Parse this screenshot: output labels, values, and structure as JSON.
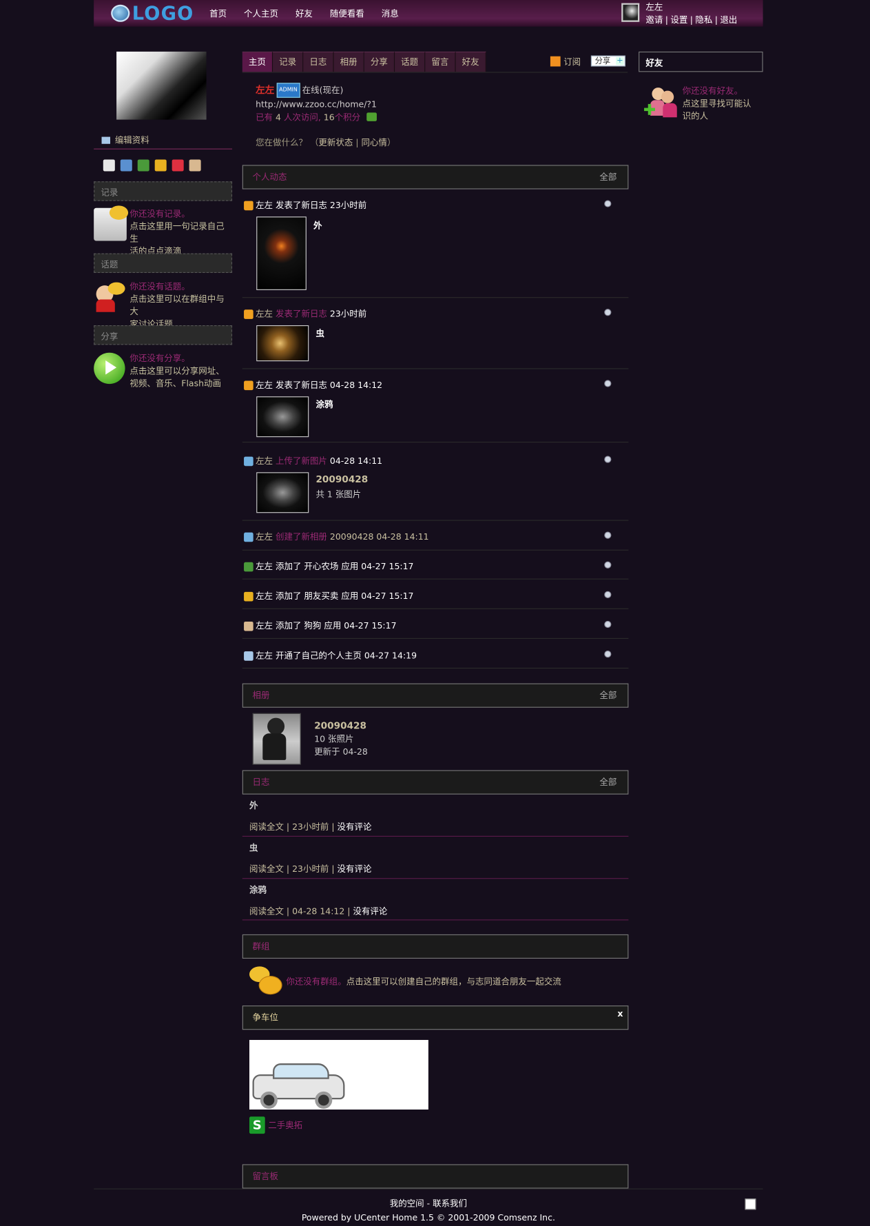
{
  "header": {
    "logo_text": "LOGO",
    "nav": [
      "首页",
      "个人主页",
      "好友",
      "随便看看",
      "消息"
    ],
    "user_name": "左左",
    "user_links": [
      "邀请",
      "设置",
      "隐私",
      "退出"
    ]
  },
  "sidebar": {
    "edit_profile": "编辑资料",
    "sections": [
      {
        "title": "记录",
        "empty": "你还没有记录。",
        "desc1": "点击这里用一句记录自己生",
        "desc2": "活的点点滴滴"
      },
      {
        "title": "话题",
        "empty": "你还没有话题。",
        "desc1": "点击这里可以在群组中与大",
        "desc2": "家讨论话题"
      },
      {
        "title": "分享",
        "empty": "你还没有分享。",
        "desc1": "点击这里可以分享网址、",
        "desc2": "视频、音乐、Flash动画"
      }
    ]
  },
  "tabs": [
    "主页",
    "记录",
    "日志",
    "相册",
    "分享",
    "话题",
    "留言",
    "好友"
  ],
  "toolbar": {
    "subscribe": "订阅",
    "share": "分享",
    "share_plus": "+"
  },
  "profile": {
    "name": "左左",
    "badge": "ADMIN",
    "online": "在线(现在)",
    "url": "http://www.zzoo.cc/home/?1",
    "stats_pre": "已有",
    "visits": "4",
    "visits_label": "人次访问,",
    "points": "16",
    "points_label": "个积分",
    "status_question": "您在做什么？",
    "update_status": "更新状态",
    "mood": "同心情"
  },
  "feed_box": {
    "title": "个人动态",
    "more": "全部"
  },
  "feed": [
    {
      "user": "左左",
      "action": "发表了新日志",
      "time": "23小时前",
      "title": "外"
    },
    {
      "user": "左左",
      "action": "发表了新日志",
      "time": "23小时前",
      "title": "虫"
    },
    {
      "user": "左左",
      "action": "发表了新日志",
      "time": "04-28 14:12",
      "title": "涂鸦"
    },
    {
      "user": "左左",
      "action": "上传了新图片",
      "time": "04-28 14:11",
      "title": "20090428",
      "sub": "共 1 张图片"
    },
    {
      "user": "左左",
      "action": "创建了新相册",
      "time": "20090428 04-28 14:11"
    },
    {
      "user": "左左",
      "action": "添加了 开心农场 应用",
      "time": "04-27 15:17"
    },
    {
      "user": "左左",
      "action": "添加了 朋友买卖 应用",
      "time": "04-27 15:17"
    },
    {
      "user": "左左",
      "action": "添加了 狗狗 应用",
      "time": "04-27 15:17"
    },
    {
      "user": "左左",
      "action": "开通了自己的个人主页",
      "time": "04-27 14:19"
    }
  ],
  "album_box": {
    "title": "相册",
    "more": "全部",
    "name": "20090428",
    "count": "10 张照片",
    "updated": "更新于  04-28"
  },
  "blog_box": {
    "title": "日志",
    "more": "全部"
  },
  "blogs": [
    {
      "title": "外",
      "read": "阅读全文",
      "time": "23小时前",
      "comments": "没有评论"
    },
    {
      "title": "虫",
      "read": "阅读全文",
      "time": "23小时前",
      "comments": "没有评论"
    },
    {
      "title": "涂鸦",
      "read": "阅读全文",
      "time": "04-28 14:12",
      "comments": "没有评论"
    }
  ],
  "group_box": {
    "title": "群组",
    "empty": "你还没有群组。",
    "desc": "点击这里可以创建自己的群组，与志同道合朋友一起交流"
  },
  "parking_box": {
    "title": "争车位",
    "close": "x",
    "car_name": "二手奥拓"
  },
  "guestbook_box": {
    "title": "留言板"
  },
  "friends_box": {
    "title": "好友",
    "empty": "你还没有好友。",
    "desc1": "点这里寻找可能认",
    "desc2": "识的人"
  },
  "footer": {
    "links": "我的空间  - 联系我们",
    "powered": "Powered by UCenter Home 1.5 © 2001-2009 Comsenz Inc."
  }
}
